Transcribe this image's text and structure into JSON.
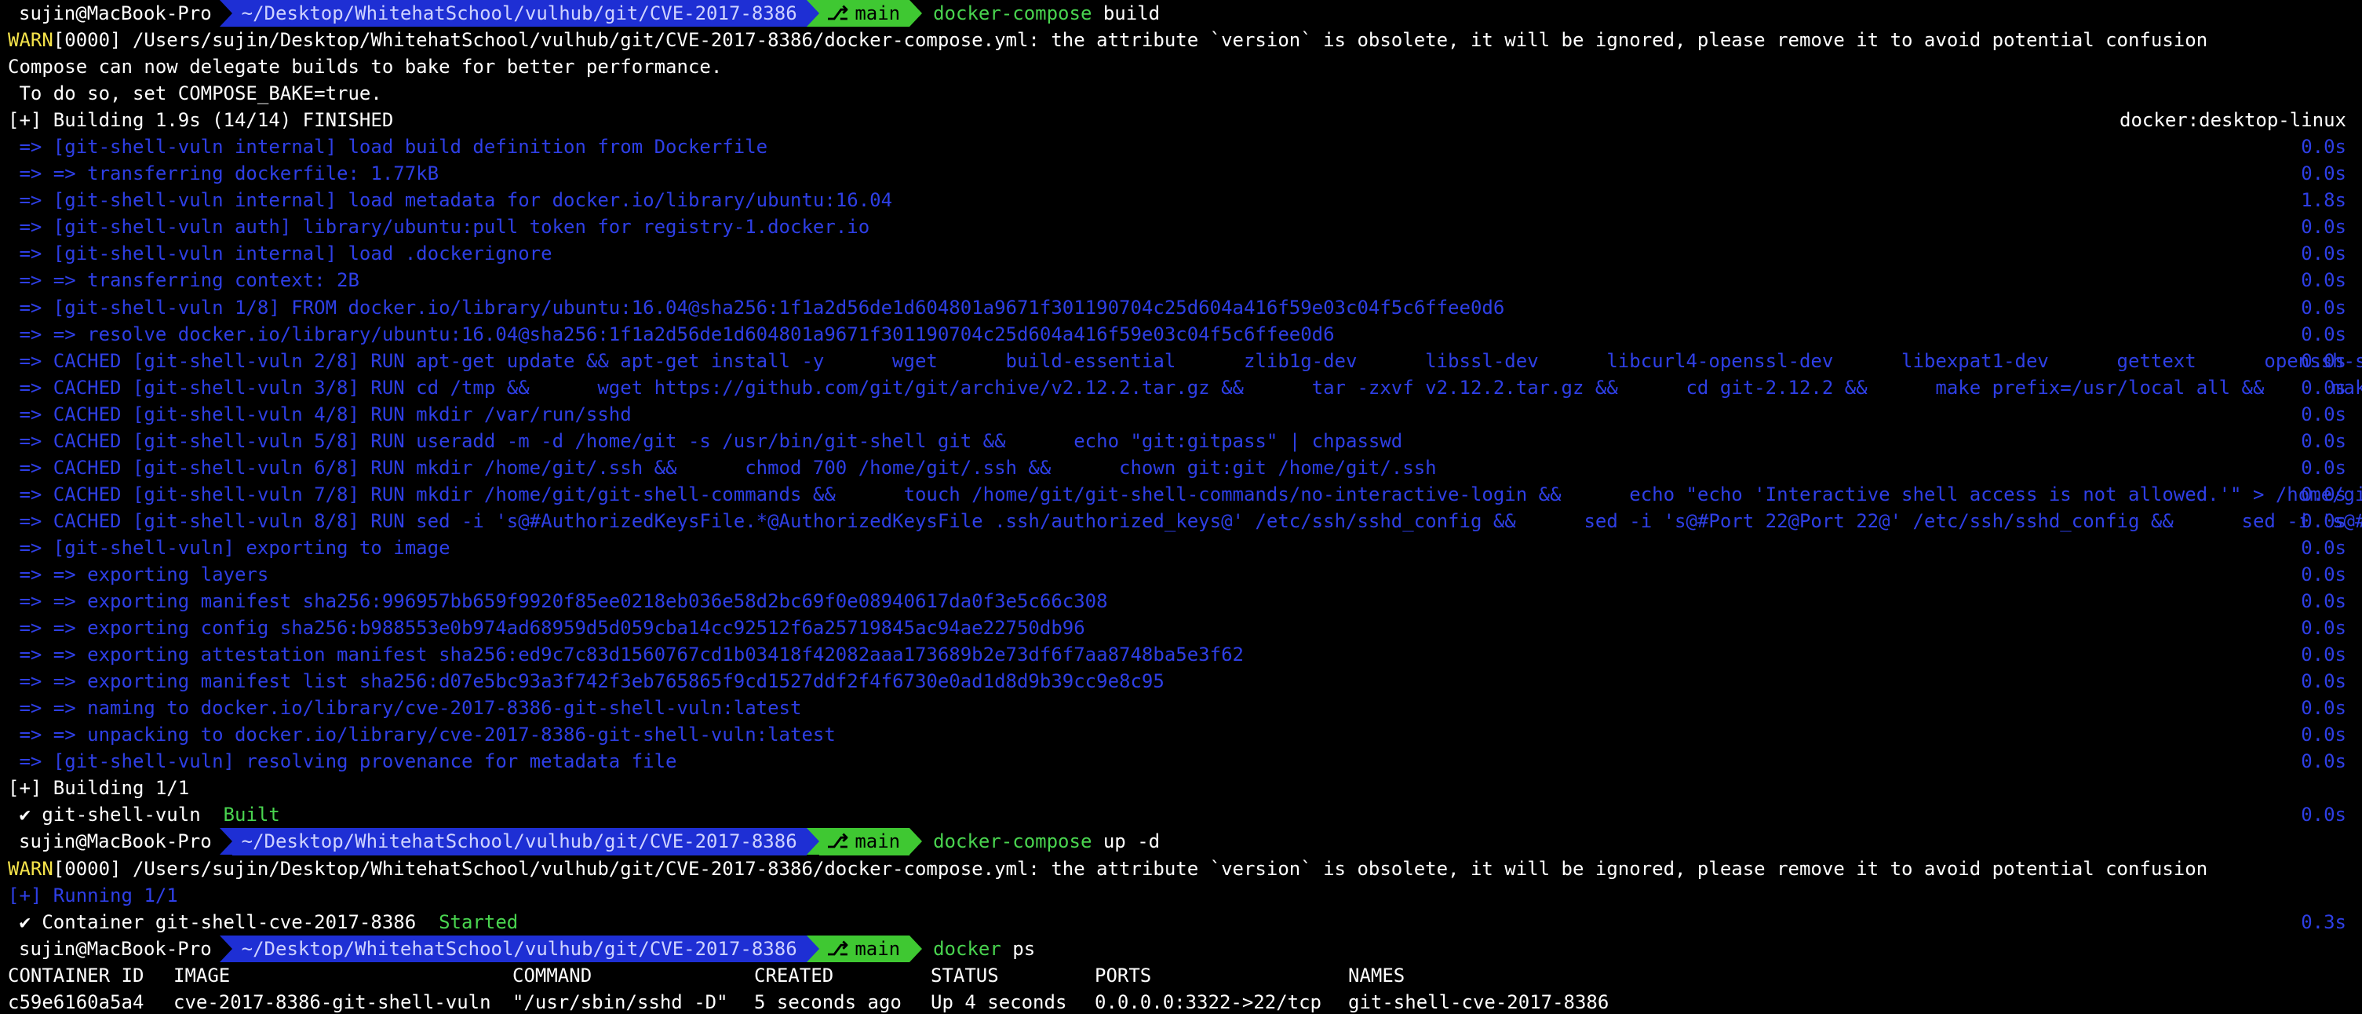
{
  "prompt": {
    "user_host": "sujin@MacBook-Pro",
    "path": "~/Desktop/WhitehatSchool/vulhub/git/CVE-2017-8386",
    "branch": "main",
    "branch_icon": "git-branch-icon"
  },
  "cmd1": {
    "name": "docker-compose",
    "args": " build"
  },
  "build_output": {
    "warn_prefix": "WARN",
    "warn_rest": "[0000] /Users/sujin/Desktop/WhitehatSchool/vulhub/git/CVE-2017-8386/docker-compose.yml: the attribute `version` is obsolete, it will be ignored, please remove it to avoid potential confusion",
    "bake_line1": "Compose can now delegate builds to bake for better performance.",
    "bake_line2": " To do so, set COMPOSE_BAKE=true.",
    "building_header": "[+] Building 1.9s (14/14) FINISHED",
    "builder": "docker:desktop-linux",
    "steps": [
      {
        "text": " => [git-shell-vuln internal] load build definition from Dockerfile",
        "time": "0.0s"
      },
      {
        "text": " => => transferring dockerfile: 1.77kB",
        "time": "0.0s"
      },
      {
        "text": " => [git-shell-vuln internal] load metadata for docker.io/library/ubuntu:16.04",
        "time": "1.8s"
      },
      {
        "text": " => [git-shell-vuln auth] library/ubuntu:pull token for registry-1.docker.io",
        "time": "0.0s"
      },
      {
        "text": " => [git-shell-vuln internal] load .dockerignore",
        "time": "0.0s"
      },
      {
        "text": " => => transferring context: 2B",
        "time": "0.0s"
      },
      {
        "text": " => [git-shell-vuln 1/8] FROM docker.io/library/ubuntu:16.04@sha256:1f1a2d56de1d604801a9671f301190704c25d604a416f59e03c04f5c6ffee0d6",
        "time": "0.0s"
      },
      {
        "text": " => => resolve docker.io/library/ubuntu:16.04@sha256:1f1a2d56de1d604801a9671f301190704c25d604a416f59e03c04f5c6ffee0d6",
        "time": "0.0s"
      },
      {
        "text": " => CACHED [git-shell-vuln 2/8] RUN apt-get update && apt-get install -y      wget      build-essential      zlib1g-dev      libssl-dev      libcurl4-openssl-dev      libexpat1-dev      gettext      openssh-server",
        "time": "0.0s"
      },
      {
        "text": " => CACHED [git-shell-vuln 3/8] RUN cd /tmp &&      wget https://github.com/git/git/archive/v2.12.2.tar.gz &&      tar -zxvf v2.12.2.tar.gz &&      cd git-2.12.2 &&      make prefix=/usr/local all &&      make pr",
        "time": "0.0s"
      },
      {
        "text": " => CACHED [git-shell-vuln 4/8] RUN mkdir /var/run/sshd",
        "time": "0.0s"
      },
      {
        "text": " => CACHED [git-shell-vuln 5/8] RUN useradd -m -d /home/git -s /usr/bin/git-shell git &&      echo \"git:gitpass\" | chpasswd",
        "time": "0.0s"
      },
      {
        "text": " => CACHED [git-shell-vuln 6/8] RUN mkdir /home/git/.ssh &&      chmod 700 /home/git/.ssh &&      chown git:git /home/git/.ssh",
        "time": "0.0s"
      },
      {
        "text": " => CACHED [git-shell-vuln 7/8] RUN mkdir /home/git/git-shell-commands &&      touch /home/git/git-shell-commands/no-interactive-login &&      echo \"echo 'Interactive shell access is not allowed.'\" > /home/git",
        "time": "0.0s"
      },
      {
        "text": " => CACHED [git-shell-vuln 8/8] RUN sed -i 's@#AuthorizedKeysFile.*@AuthorizedKeysFile .ssh/authorized_keys@' /etc/ssh/sshd_config &&      sed -i 's@#Port 22@Port 22@' /etc/ssh/sshd_config &&      sed -i 's@#P",
        "time": "0.0s"
      },
      {
        "text": " => [git-shell-vuln] exporting to image",
        "time": "0.0s"
      },
      {
        "text": " => => exporting layers",
        "time": "0.0s"
      },
      {
        "text": " => => exporting manifest sha256:996957bb659f9920f85ee0218eb036e58d2bc69f0e08940617da0f3e5c66c308",
        "time": "0.0s"
      },
      {
        "text": " => => exporting config sha256:b988553e0b974ad68959d5d059cba14cc92512f6a25719845ac94ae22750db96",
        "time": "0.0s"
      },
      {
        "text": " => => exporting attestation manifest sha256:ed9c7c83d1560767cd1b03418f42082aaa173689b2e73df6f7aa8748ba5e3f62",
        "time": "0.0s"
      },
      {
        "text": " => => exporting manifest list sha256:d07e5bc93a3f742f3eb765865f9cd1527ddf2f4f6730e0ad1d8d9b39cc9e8c95",
        "time": "0.0s"
      },
      {
        "text": " => => naming to docker.io/library/cve-2017-8386-git-shell-vuln:latest",
        "time": "0.0s"
      },
      {
        "text": " => => unpacking to docker.io/library/cve-2017-8386-git-shell-vuln:latest",
        "time": "0.0s"
      },
      {
        "text": " => [git-shell-vuln] resolving provenance for metadata file",
        "time": "0.0s"
      }
    ],
    "building_summary": "[+] Building 1/1",
    "built_check": " ✔ git-shell-vuln  ",
    "built_status": "Built",
    "built_time": "0.0s"
  },
  "cmd2": {
    "name": "docker-compose",
    "args": " up -d"
  },
  "up_output": {
    "warn_prefix": "WARN",
    "warn_rest": "[0000] /Users/sujin/Desktop/WhitehatSchool/vulhub/git/CVE-2017-8386/docker-compose.yml: the attribute `version` is obsolete, it will be ignored, please remove it to avoid potential confusion",
    "running": "[+] Running 1/1",
    "container_check": " ✔ Container git-shell-cve-2017-8386  ",
    "container_status": "Started",
    "container_time": "0.3s"
  },
  "cmd3": {
    "name": "docker",
    "args": " ps"
  },
  "ps_table": {
    "headers": [
      "CONTAINER ID",
      "IMAGE",
      "COMMAND",
      "CREATED",
      "STATUS",
      "PORTS",
      "NAMES"
    ],
    "row": [
      "c59e6160a5a4",
      "cve-2017-8386-git-shell-vuln",
      "\"/usr/sbin/sshd -D\"",
      "5 seconds ago",
      "Up 4 seconds",
      "0.0.0.0:3322->22/tcp",
      "git-shell-cve-2017-8386"
    ]
  }
}
